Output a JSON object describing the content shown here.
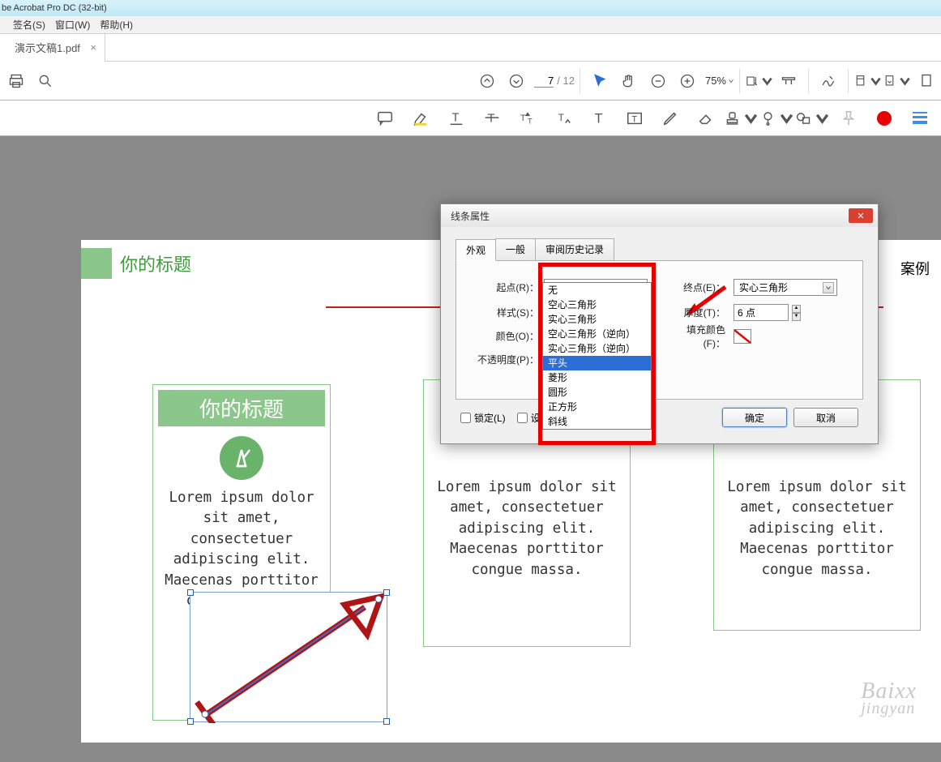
{
  "app": {
    "title": "be Acrobat Pro DC (32-bit)"
  },
  "menu": {
    "sign": "签名(S)",
    "window": "窗口(W)",
    "help": "帮助(H)"
  },
  "tab": {
    "name": "演示文稿1.pdf",
    "close": "×"
  },
  "toolbar": {
    "page_current": "7",
    "page_total": "/ 12",
    "zoom": "75%"
  },
  "doc": {
    "title": "你的标题",
    "title_right": "案例",
    "card_title": "你的标题",
    "lorem": "Lorem ipsum dolor sit amet, consectetuer adipiscing elit. Maecenas porttitor congue massa."
  },
  "dialog": {
    "title": "线条属性",
    "tabs": {
      "appearance": "外观",
      "general": "一般",
      "history": "审阅历史记录"
    },
    "labels": {
      "start": "起点(R)：",
      "end": "终点(E)：",
      "style": "样式(S)：",
      "thickness": "厚度(T)：",
      "color": "颜色(O)：",
      "fill": "填充颜色(F)：",
      "opacity": "不透明度(P)："
    },
    "values": {
      "start": "平头",
      "end": "实心三角形",
      "thickness": "6 点"
    },
    "options": [
      "无",
      "空心三角形",
      "实心三角形",
      "空心三角形（逆向）",
      "实心三角形（逆向）",
      "平头",
      "菱形",
      "圆形",
      "正方形",
      "斜线"
    ],
    "selected_option": "平头",
    "lock": "锁定(L)",
    "default": "设为默认属性(M)",
    "ok": "确定",
    "cancel": "取消"
  },
  "watermark": {
    "line1": "Baixx",
    "line2": "jingyan"
  }
}
